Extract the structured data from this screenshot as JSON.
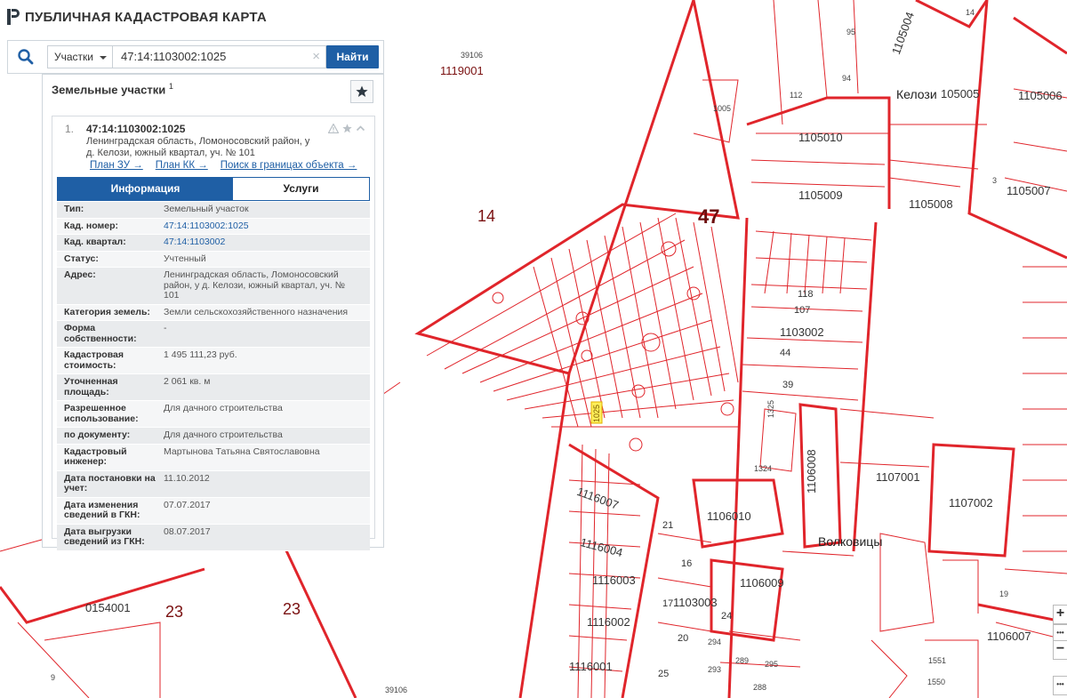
{
  "app": {
    "title": "ПУБЛИЧНАЯ КАДАСТРОВАЯ КАРТА"
  },
  "search": {
    "type_selected": "Участки",
    "query": "47:14:1103002:1025",
    "clear_glyph": "×",
    "find_label": "Найти"
  },
  "panel": {
    "title": "Земельные участки",
    "count": "1",
    "result": {
      "index": "1.",
      "number": "47:14:1103002:1025",
      "address": "Ленинградская область, Ломоносовский район, у д. Келози, южный квартал, уч. № 101",
      "links": [
        "План ЗУ →",
        "План КК →",
        "Поиск в границах объекта →"
      ],
      "tabs": {
        "info": "Информация",
        "services": "Услуги"
      },
      "properties": [
        {
          "key": "Тип:",
          "value": "Земельный участок"
        },
        {
          "key": "Кад. номер:",
          "value": "47:14:1103002:1025"
        },
        {
          "key": "Кад. квартал:",
          "value": "47:14:1103002"
        },
        {
          "key": "Статус:",
          "value": "Учтенный"
        },
        {
          "key": "Адрес:",
          "value": "Ленинградская область, Ломоносовский район, у д. Келози, южный квартал, уч. № 101"
        },
        {
          "key": "Категория земель:",
          "value": "Земли сельскохозяйственного назначения"
        },
        {
          "key": "Форма собственности:",
          "value": "-"
        },
        {
          "key": "Кадастровая стоимость:",
          "value": "1 495 111,23 руб."
        },
        {
          "key": "Уточненная площадь:",
          "value": "2 061 кв. м"
        },
        {
          "key": "Разрешенное использование:",
          "value": "Для дачного строительства"
        },
        {
          "key": "по документу:",
          "value": "Для дачного строительства"
        },
        {
          "key": "Кадастровый инженер:",
          "value": "Мартынова Татьяна Святославовна"
        },
        {
          "key": "Дата постановки на учет:",
          "value": "11.10.2012"
        },
        {
          "key": "Дата изменения сведений в ГКН:",
          "value": "07.07.2017"
        },
        {
          "key": "Дата выгрузки сведений из ГКН:",
          "value": "08.07.2017"
        }
      ]
    }
  },
  "map": {
    "parcel_color": "#e0252b",
    "labels": {
      "l39106_top": "39106",
      "l1119001": "1119001",
      "l14_big": "14",
      "l47": "47",
      "l1105010": "1105010",
      "l1105009": "1105009",
      "l1105008": "1105008",
      "l1105007": "1105007",
      "l1105006": "1105006",
      "l105005": "105005",
      "kelozi": "Келози",
      "l1105004": "1105004",
      "l1103002": "1103002",
      "l107": "107",
      "l118": "118",
      "l44": "44",
      "l39": "39",
      "l1325": "1325",
      "l1324": "1324",
      "l1106008": "1106008",
      "l1107001": "1107001",
      "l1107002": "1107002",
      "l1106010": "1106010",
      "l1106009": "1106009",
      "volkovitsy": "Волковицы",
      "l1116007": "1116007",
      "l1116004": "1116004",
      "l1116003": "1116003",
      "l1116002": "1116002",
      "l1116001": "1116001",
      "l1103003": "1103003",
      "l1106007": "1106007",
      "l0154001": "0154001",
      "l23a": "23",
      "l23b": "23",
      "l39106_bot": "39106",
      "l1551": "1551",
      "l1550": "1550",
      "l21": "21",
      "l16": "16",
      "l17": "17",
      "l24": "24",
      "l20": "20",
      "l25": "25",
      "l9": "9",
      "l3": "3",
      "l95": "95",
      "l94": "94",
      "l112": "112",
      "l1005": "1005",
      "l19": "19",
      "l14_small": "14",
      "l294": "294",
      "l293": "293",
      "l289": "289",
      "l295": "295",
      "l288": "288",
      "l1025": "1025"
    },
    "zoom": {
      "in": "+",
      "out": "−",
      "more": "•••"
    }
  }
}
